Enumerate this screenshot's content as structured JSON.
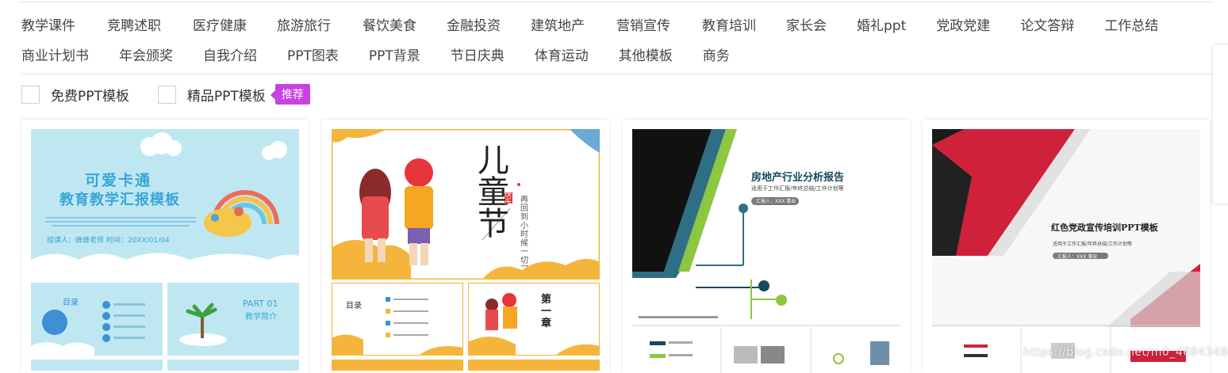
{
  "categories": {
    "row1": [
      "教学课件",
      "竞聘述职",
      "医疗健康",
      "旅游旅行",
      "餐饮美食",
      "金融投资",
      "建筑地产",
      "营销宣传",
      "教育培训",
      "家长会",
      "婚礼ppt",
      "党政党建",
      "论文答辩",
      "工作总结"
    ],
    "row2": [
      "商业计划书",
      "年会颁奖",
      "自我介绍",
      "PPT图表",
      "PPT背景",
      "节日庆典",
      "体育运动",
      "其他模板",
      "商务"
    ]
  },
  "filters": {
    "free_label": "免费PPT模板",
    "premium_label": "精品PPT模板",
    "badge": "推荐"
  },
  "cards": {
    "c1": {
      "title_line1": "可爱卡通",
      "title_line2": "教育教学汇报模板",
      "presenter": "授课人：蜂蜂老师   时间：20XX/01/04",
      "sub1_label": "目录",
      "sub2_label": "PART 01",
      "sub2_caption": "教学简介"
    },
    "c2": {
      "title": "儿童节",
      "tag": "快乐",
      "slogan": "再回到小时候 一切归为初心",
      "sub1_label": "目录",
      "sub2_label": "第一章"
    },
    "c3": {
      "title": "房地产行业分析报告",
      "subtitle": "适用于工作汇报/年终总结/工作计划等",
      "pill": "汇报人：XXX 事业"
    },
    "c4": {
      "title": "红色党政宣传培训PPT模板",
      "subtitle": "适用于工作汇报/年终总结/工作计划等",
      "pill": "汇报人：XXX 事业"
    }
  },
  "watermark": "https://blog.csdn.net/m0_46843484",
  "colors": {
    "accent_purple": "#c842e0",
    "card1_bg": "#bfe7f2",
    "card2_yellow": "#f5b53d",
    "card3_green": "#8dc63f",
    "card3_navy": "#16495f",
    "card4_red": "#d0213a"
  }
}
